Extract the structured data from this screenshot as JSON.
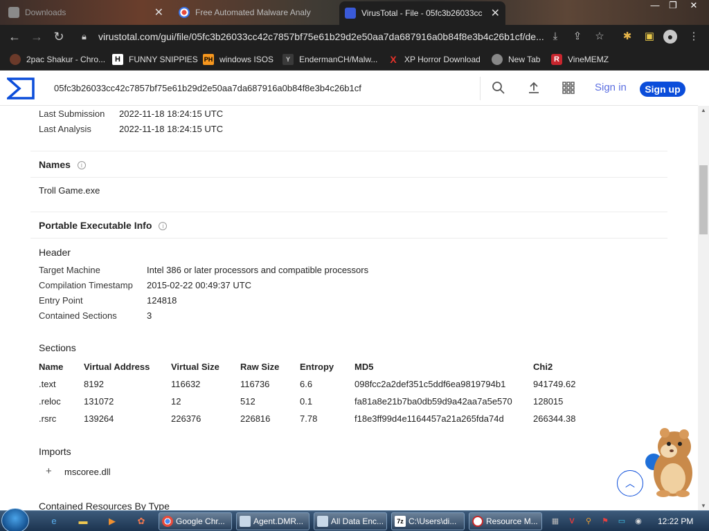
{
  "browser": {
    "tabs": [
      {
        "title": "Downloads"
      },
      {
        "title": "Free Automated Malware Analy"
      },
      {
        "title": "VirusTotal - File - 05fc3b26033cc"
      }
    ],
    "url": "virustotal.com/gui/file/05fc3b26033cc42c7857bf75e61b29d2e50aa7da687916a0b84f8e3b4c26b1cf/de...",
    "bookmarks": [
      {
        "label": "2pac Shakur - Chro..."
      },
      {
        "label": "FUNNY SNIPPIES",
        "icon_text": "H"
      },
      {
        "label": "windows ISOS",
        "icon_text": "PH"
      },
      {
        "label": "EndermanCH/Malw..."
      },
      {
        "label": "XP Horror Download",
        "icon_text": "X"
      },
      {
        "label": "New Tab"
      },
      {
        "label": "VineMEMZ",
        "icon_text": "R"
      }
    ]
  },
  "vt": {
    "search_value": "05fc3b26033cc42c7857bf75e61b29d2e50aa7da687916a0b84f8e3b4c26b1cf",
    "sign_in": "Sign in",
    "sign_up": "Sign up",
    "accent": "#0b4dda"
  },
  "history": {
    "last_submission_label": "Last Submission",
    "last_submission": "2022-11-18 18:24:15 UTC",
    "last_analysis_label": "Last Analysis",
    "last_analysis": "2022-11-18 18:24:15 UTC"
  },
  "names": {
    "title": "Names",
    "values": [
      "Troll Game.exe"
    ]
  },
  "pe": {
    "title": "Portable Executable Info",
    "header_title": "Header",
    "header_rows": [
      {
        "label": "Target Machine",
        "value": "Intel 386 or later processors and compatible processors"
      },
      {
        "label": "Compilation Timestamp",
        "value": "2015-02-22 00:49:37 UTC"
      },
      {
        "label": "Entry Point",
        "value": "124818"
      },
      {
        "label": "Contained Sections",
        "value": "3"
      }
    ],
    "sections_title": "Sections",
    "sections_columns": [
      "Name",
      "Virtual Address",
      "Virtual Size",
      "Raw Size",
      "Entropy",
      "MD5",
      "Chi2"
    ],
    "sections_rows": [
      [
        ".text",
        "8192",
        "116632",
        "116736",
        "6.6",
        "098fcc2a2def351c5ddf6ea9819794b1",
        "941749.62"
      ],
      [
        ".reloc",
        "131072",
        "12",
        "512",
        "0.1",
        "fa81a8e21b7ba0db59d9a42aa7a5e570",
        "128015"
      ],
      [
        ".rsrc",
        "139264",
        "226376",
        "226816",
        "7.78",
        "f18e3ff99d4e1164457a21a265fda74d",
        "266344.38"
      ]
    ],
    "imports_title": "Imports",
    "imports": [
      "mscoree.dll"
    ],
    "resources_title": "Contained Resources By Type"
  },
  "taskbar": {
    "items": [
      {
        "label": "Google Chr..."
      },
      {
        "label": "Agent.DMR..."
      },
      {
        "label": "All Data Enc..."
      },
      {
        "label": "C:\\Users\\di..."
      },
      {
        "label": "Resource M..."
      }
    ],
    "clock": "12:22 PM"
  }
}
